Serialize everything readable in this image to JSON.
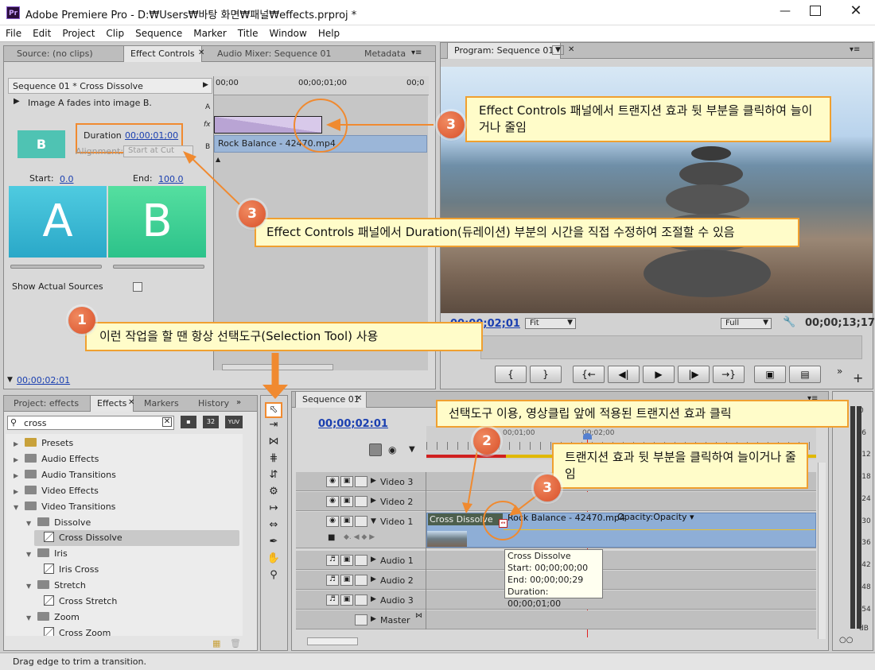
{
  "window": {
    "title": "Adobe Premiere Pro - D:₩Users₩바탕 화면₩패널₩effects.prproj *",
    "app_icon": "Pr"
  },
  "menu": [
    "File",
    "Edit",
    "Project",
    "Clip",
    "Sequence",
    "Marker",
    "Title",
    "Window",
    "Help"
  ],
  "top_left_tabs": [
    "Source: (no clips)",
    "Effect Controls",
    "Audio Mixer: Sequence 01",
    "Metadata"
  ],
  "effect_controls": {
    "header": "Sequence 01 * Cross Dissolve",
    "description": "Image A fades into image B.",
    "duration_label": "Duration",
    "duration_value": "00;00;01;00",
    "alignment_label": "Alignment:",
    "alignment_value": "Start at Cut",
    "start_label": "Start:",
    "start_value": "0.0",
    "end_label": "End:",
    "end_value": "100.0",
    "a_label": "A",
    "b_label": "B",
    "show_actual_sources": "Show Actual Sources",
    "timecode": "00;00;02;01",
    "ruler_start": "00;00",
    "ruler_mid": "00;00;01;00",
    "ruler_end": "00;0",
    "track_a": "A",
    "track_fx": "fx",
    "track_b": "B",
    "clip_name": "Rock Balance - 42470.mp4"
  },
  "program": {
    "tab": "Program: Sequence 01",
    "timecode": "00;00;02;01",
    "fit": "Fit",
    "quality": "Full",
    "duration": "00;00;13;17"
  },
  "bottom_left_tabs": [
    "Project: effects",
    "Effects",
    "Markers",
    "History"
  ],
  "effects": {
    "search_value": "cross",
    "icon_32": "32",
    "icon_yuv": "YUV",
    "tree": [
      {
        "label": "Presets",
        "level": 0,
        "open": false
      },
      {
        "label": "Audio Effects",
        "level": 0,
        "open": false
      },
      {
        "label": "Audio Transitions",
        "level": 0,
        "open": false
      },
      {
        "label": "Video Effects",
        "level": 0,
        "open": false
      },
      {
        "label": "Video Transitions",
        "level": 0,
        "open": true
      },
      {
        "label": "Dissolve",
        "level": 1,
        "open": true
      },
      {
        "label": "Cross Dissolve",
        "level": 2,
        "selected": true
      },
      {
        "label": "Iris",
        "level": 1,
        "open": true
      },
      {
        "label": "Iris Cross",
        "level": 2
      },
      {
        "label": "Stretch",
        "level": 1,
        "open": true
      },
      {
        "label": "Cross Stretch",
        "level": 2
      },
      {
        "label": "Zoom",
        "level": 1,
        "open": true
      },
      {
        "label": "Cross Zoom",
        "level": 2
      }
    ]
  },
  "timeline": {
    "tab": "Sequence 01",
    "timecode": "00;00;02:01",
    "ruler_labels": [
      "00;01;00",
      "00;02;00"
    ],
    "tracks": [
      "Video 3",
      "Video 2",
      "Video 1",
      "Audio 1",
      "Audio 2",
      "Audio 3",
      "Master"
    ],
    "transition_label": "Cross Dissolve",
    "clip_label": "Rock Balance - 42470.mp4",
    "opacity_label": "Opacity:Opacity",
    "tooltip": [
      "Cross Dissolve",
      "Start: 00;00;00;00",
      "End: 00;00;00;29",
      "Duration: 00;00;01;00"
    ]
  },
  "meter": {
    "labels": [
      "0",
      "-6",
      "-12",
      "-18",
      "-24",
      "-30",
      "-36",
      "-42",
      "-48",
      "-54",
      "dB"
    ]
  },
  "status": "Drag edge to trim a transition.",
  "annotations": {
    "badge1": "1",
    "badge2": "2",
    "badge3": "3",
    "callout_top_right": "Effect Controls 패널에서 트랜지션 효과 뒷 부분을 클릭하여 늘이거나 줄임",
    "callout_duration": "Effect Controls 패널에서 Duration(듀레이션) 부분의 시간을 직접 수정하여 조절할 수 있음",
    "callout_selection": "이런 작업을 할 땐 항상 선택도구(Selection Tool) 사용",
    "callout_clip": "선택도구 이용, 영상클립 앞에 적용된 트랜지션 효과 클릭",
    "callout_trim": "트랜지션 효과 뒷 부분을 클릭하여 늘이거나 줄임"
  }
}
